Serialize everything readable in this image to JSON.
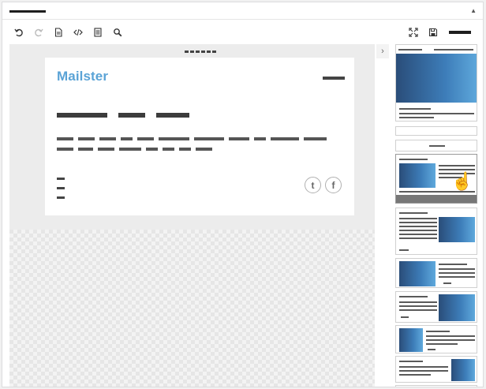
{
  "app": {
    "hand_cursor_glyph": "☝",
    "collapse_glyph": "▲",
    "sidebar_toggle_glyph": "›"
  },
  "email": {
    "logo_text": "Mailster",
    "social": {
      "twitter_glyph": "t",
      "facebook_glyph": "f"
    }
  },
  "colors": {
    "brand": "#5aa3d6",
    "gradient_dark": "#2a4d79",
    "gradient_light": "#5fa9dc"
  },
  "icons": [
    "undo-icon",
    "redo-icon",
    "document-icon",
    "code-icon",
    "list-icon",
    "search-icon",
    "fullscreen-icon",
    "save-icon"
  ]
}
